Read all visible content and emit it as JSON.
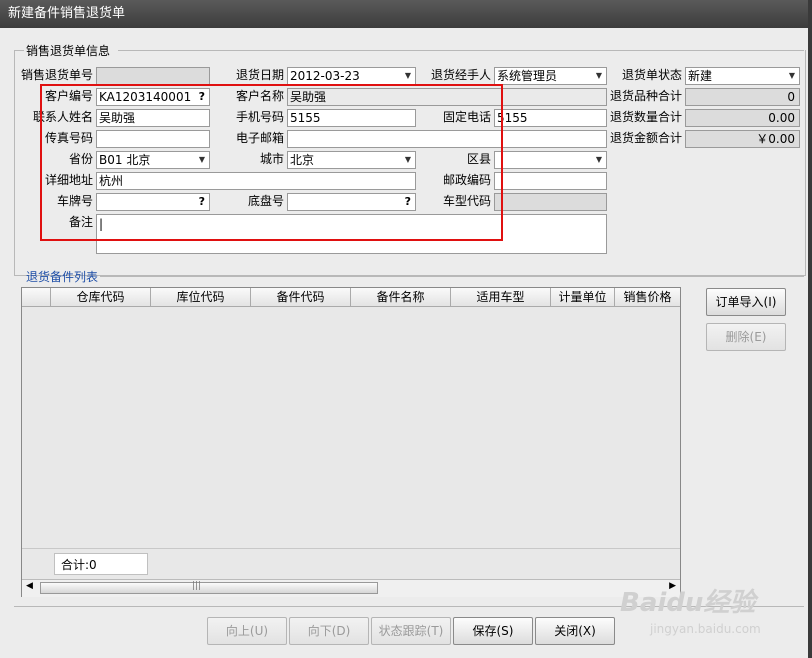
{
  "window": {
    "title": "新建备件销售退货单"
  },
  "info_section": {
    "title": "销售退货单信息"
  },
  "form": {
    "return_no": {
      "label": "销售退货单号",
      "value": ""
    },
    "return_date": {
      "label": "退货日期",
      "value": "2012-03-23"
    },
    "handler": {
      "label": "退货经手人",
      "value": "系统管理员"
    },
    "status": {
      "label": "退货单状态",
      "value": "新建"
    },
    "customer_code": {
      "label": "客户编号",
      "value": "KA1203140001"
    },
    "customer_name": {
      "label": "客户名称",
      "value": "吴助强"
    },
    "variety_total": {
      "label": "退货品种合计",
      "value": "0"
    },
    "contact_name": {
      "label": "联系人姓名",
      "value": "吴助强"
    },
    "mobile": {
      "label": "手机号码",
      "value": "5155"
    },
    "phone": {
      "label": "固定电话",
      "value": "5155"
    },
    "qty_total": {
      "label": "退货数量合计",
      "value": "0.00"
    },
    "fax": {
      "label": "传真号码",
      "value": ""
    },
    "email": {
      "label": "电子邮箱",
      "value": ""
    },
    "amount_total": {
      "label": "退货金额合计",
      "value": "￥0.00"
    },
    "province": {
      "label": "省份",
      "value": "B01 北京"
    },
    "city": {
      "label": "城市",
      "value": "北京"
    },
    "district": {
      "label": "区县",
      "value": ""
    },
    "address": {
      "label": "详细地址",
      "value": "杭州"
    },
    "postcode": {
      "label": "邮政编码",
      "value": ""
    },
    "plate": {
      "label": "车牌号",
      "value": ""
    },
    "chassis": {
      "label": "底盘号",
      "value": ""
    },
    "model_code": {
      "label": "车型代码",
      "value": ""
    },
    "remark": {
      "label": "备注",
      "value": "|"
    }
  },
  "parts_section": {
    "title": "退货备件列表"
  },
  "grid": {
    "columns": [
      "仓库代码",
      "库位代码",
      "备件代码",
      "备件名称",
      "适用车型",
      "计量单位",
      "销售价格"
    ],
    "total_label": "合计:0"
  },
  "side_buttons": {
    "import": "订单导入(I)",
    "delete": "删除(E)"
  },
  "bottom_buttons": {
    "prev": "向上(U)",
    "next": "向下(D)",
    "track": "状态跟踪(T)",
    "save": "保存(S)",
    "close": "关闭(X)"
  },
  "watermark": {
    "logo": "Baidu经验",
    "url": "jingyan.baidu.com"
  }
}
